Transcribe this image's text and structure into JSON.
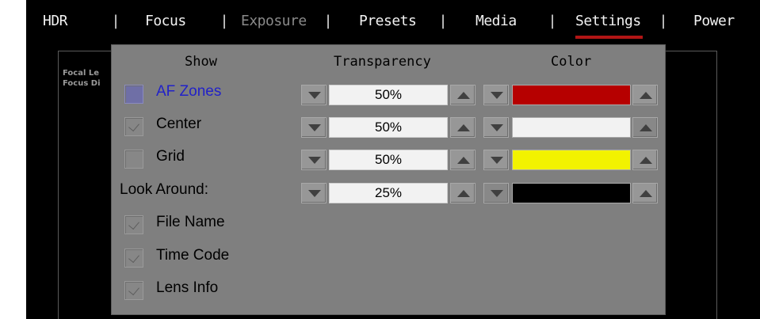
{
  "menu": {
    "items": [
      {
        "label": "HDR",
        "dim": false
      },
      {
        "label": "Focus",
        "dim": false
      },
      {
        "label": "Exposure",
        "dim": true
      },
      {
        "label": "Presets",
        "dim": false
      },
      {
        "label": "Media",
        "dim": false
      },
      {
        "label": "Settings",
        "dim": false,
        "active": true
      },
      {
        "label": "Power",
        "dim": false
      }
    ],
    "separator": "|",
    "active_underline_color": "#b11515"
  },
  "background": {
    "label1": "Focal Le",
    "label2": "Focus Di"
  },
  "panel": {
    "headers": {
      "show": "Show",
      "transparency": "Transparency",
      "color": "Color"
    },
    "rows": [
      {
        "label": "AF Zones",
        "checked": false,
        "highlight": true,
        "transparency": "50%",
        "color": "#b60000"
      },
      {
        "label": "Center",
        "checked": true,
        "highlight": false,
        "transparency": "50%",
        "color": "#f2f2f2"
      },
      {
        "label": "Grid",
        "checked": false,
        "highlight": false,
        "transparency": "50%",
        "color": "#f2f200"
      },
      {
        "label": "Look Around:",
        "transparency": "25%",
        "color": "#000000"
      }
    ],
    "checkboxes": [
      {
        "label": "File Name",
        "checked": true
      },
      {
        "label": "Time Code",
        "checked": true
      },
      {
        "label": "Lens Info",
        "checked": true
      }
    ]
  }
}
